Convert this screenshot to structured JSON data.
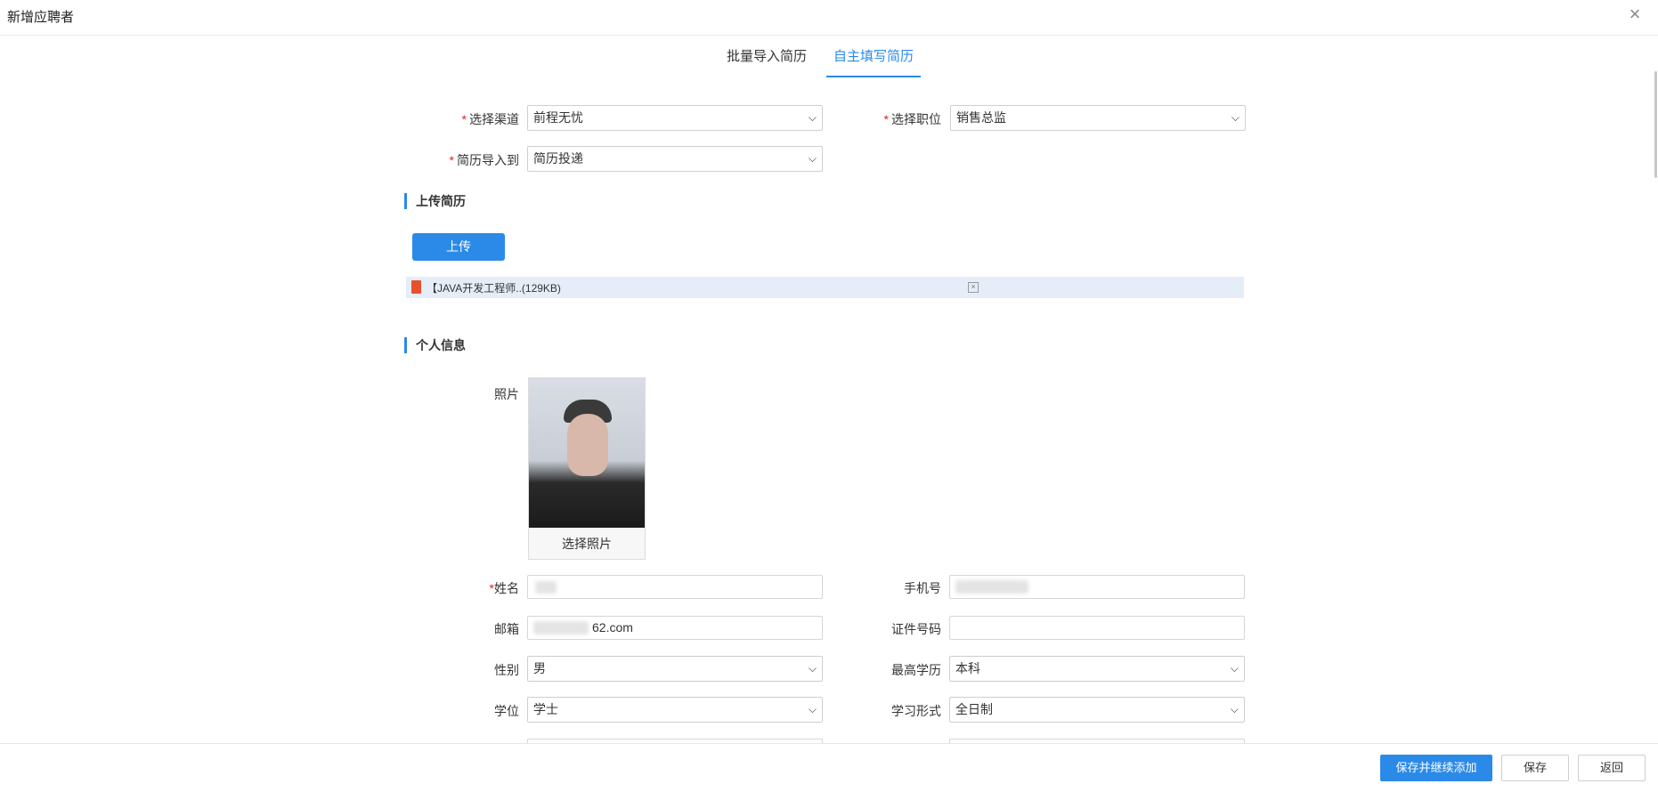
{
  "dialog": {
    "title": "新增应聘者"
  },
  "tabs": [
    {
      "label": "批量导入简历",
      "active": false
    },
    {
      "label": "自主填写简历",
      "active": true
    }
  ],
  "form_top": {
    "channel": {
      "label": "选择渠道",
      "value": "前程无忧",
      "required": true
    },
    "position": {
      "label": "选择职位",
      "value": "销售总监",
      "required": true
    },
    "import_to": {
      "label": "简历导入到",
      "value": "简历投递",
      "required": true
    }
  },
  "upload_section": {
    "title": "上传简历",
    "upload_button": "上传",
    "file": {
      "name": "【JAVA开发工程师..(129KB)",
      "icon": "pdf-file-icon"
    }
  },
  "personal_section": {
    "title": "个人信息",
    "photo": {
      "label": "照片",
      "button": "选择照片"
    },
    "name": {
      "label": "姓名",
      "required": true,
      "value": ""
    },
    "phone": {
      "label": "手机号",
      "value": ""
    },
    "email": {
      "label": "邮箱",
      "value": "62.com"
    },
    "id_number": {
      "label": "证件号码",
      "value": ""
    },
    "gender": {
      "label": "性别",
      "value": "男"
    },
    "education": {
      "label": "最高学历",
      "value": "本科"
    },
    "degree": {
      "label": "学位",
      "value": "学士"
    },
    "study_mode": {
      "label": "学习形式",
      "value": "全日制"
    }
  },
  "footer": {
    "save_continue": "保存并继续添加",
    "save": "保存",
    "back": "返回"
  },
  "colors": {
    "accent": "#2b8ae8",
    "required": "#e02020",
    "file_bar": "#e5eef8"
  }
}
